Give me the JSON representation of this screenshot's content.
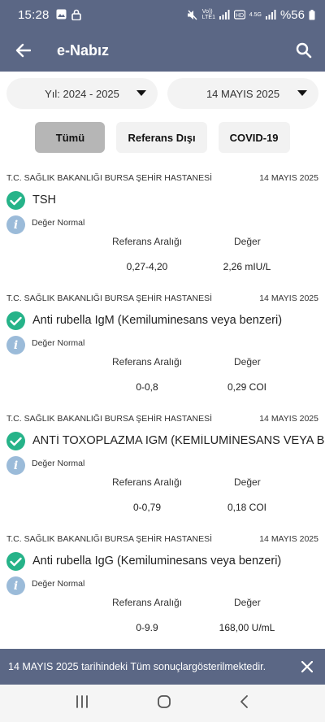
{
  "status": {
    "time": "15:28",
    "network_labels": "Vo)) LTE1",
    "network2": "4.5G",
    "battery": "%56"
  },
  "app": {
    "title": "e-Nabız"
  },
  "filters": {
    "year": "Yıl: 2024 - 2025",
    "date": "14 MAYIS 2025"
  },
  "chips": [
    {
      "label": "Tümü",
      "active": true
    },
    {
      "label": "Referans Dışı",
      "active": false
    },
    {
      "label": "COVID-19",
      "active": false
    }
  ],
  "results": [
    {
      "hospital": "T.C. SAĞLIK BAKANLIĞI BURSA ŞEHİR HASTANESİ",
      "date": "14 MAYIS 2025",
      "test": "TSH",
      "status": "Değer Normal",
      "ref_header": "Referans Aralığı",
      "value_header": "Değer",
      "ref": "0,27-4,20",
      "value": "2,26 mIU/L"
    },
    {
      "hospital": "T.C. SAĞLIK BAKANLIĞI BURSA ŞEHİR HASTANESİ",
      "date": "14 MAYIS 2025",
      "test": "Anti rubella IgM (Kemiluminesans veya benzeri)",
      "status": "Değer Normal",
      "ref_header": "Referans Aralığı",
      "value_header": "Değer",
      "ref": "0-0,8",
      "value": "0,29 COI"
    },
    {
      "hospital": "T.C. SAĞLIK BAKANLIĞI BURSA ŞEHİR HASTANESİ",
      "date": "14 MAYIS 2025",
      "test": "ANTİ TOXOPLAZMA IGM (KEMİLUMİNESANS VEYA BENZ",
      "status": "Değer Normal",
      "ref_header": "Referans Aralığı",
      "value_header": "Değer",
      "ref": "0-0,79",
      "value": "0,18 COI"
    },
    {
      "hospital": "T.C. SAĞLIK BAKANLIĞI BURSA ŞEHİR HASTANESİ",
      "date": "14 MAYIS 2025",
      "test": "Anti rubella IgG (Kemiluminesans veya benzeri)",
      "status": "Değer Normal",
      "ref_header": "Referans Aralığı",
      "value_header": "Değer",
      "ref": "0-9.9",
      "value": "168,00 U/mL"
    }
  ],
  "snackbar": {
    "message": "14 MAYIS 2025 tarihindeki Tüm sonuçlargösterilmektedir."
  },
  "colors": {
    "primary": "#5b6785",
    "success": "#26b389",
    "info": "#9bbbd9",
    "chip_active": "#b6b6b6"
  }
}
